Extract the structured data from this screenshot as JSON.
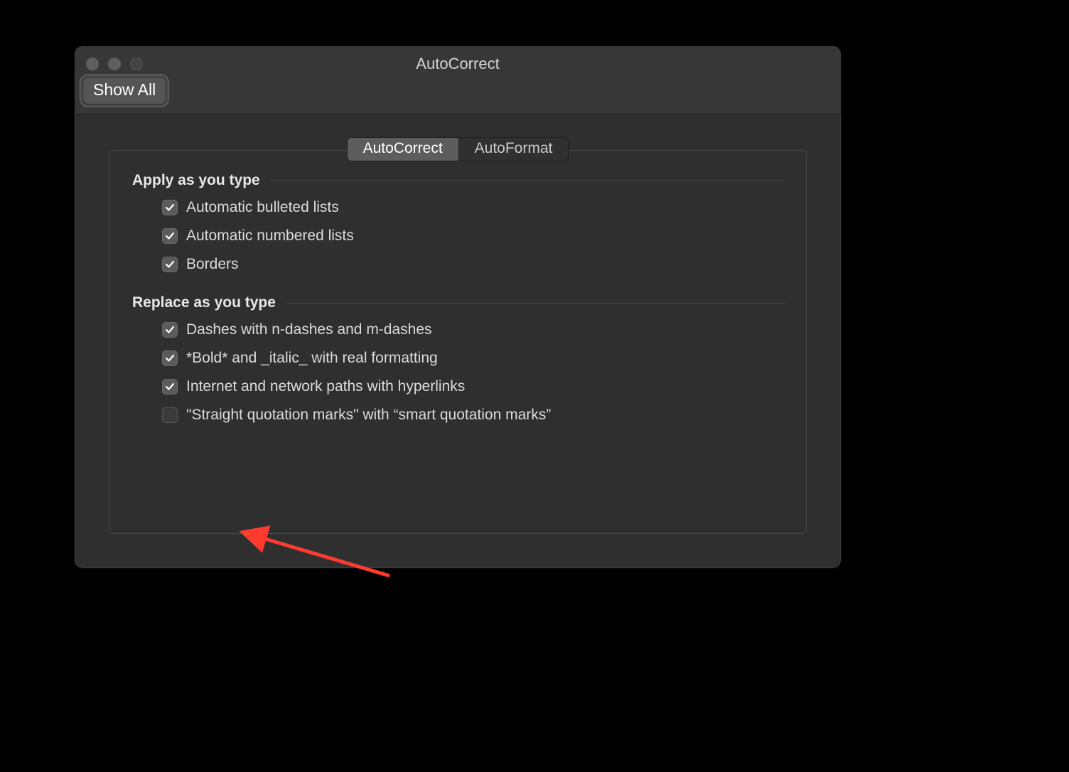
{
  "window": {
    "title": "AutoCorrect"
  },
  "toolbar": {
    "show_all_label": "Show All"
  },
  "tabs": [
    {
      "label": "AutoCorrect",
      "selected": true
    },
    {
      "label": "AutoFormat",
      "selected": false
    }
  ],
  "sections": {
    "apply": {
      "heading": "Apply as you type",
      "items": [
        {
          "label": "Automatic bulleted lists",
          "checked": true
        },
        {
          "label": "Automatic numbered lists",
          "checked": true
        },
        {
          "label": "Borders",
          "checked": true
        }
      ]
    },
    "replace": {
      "heading": "Replace as you type",
      "items": [
        {
          "label": "Dashes with n-dashes and m-dashes",
          "checked": true
        },
        {
          "label": "*Bold* and _italic_ with real formatting",
          "checked": true
        },
        {
          "label": "Internet and network paths with hyperlinks",
          "checked": true
        },
        {
          "label": "\"Straight quotation marks\" with “smart quotation marks”",
          "checked": false
        }
      ]
    }
  },
  "annotation": {
    "arrow_color": "#ff3b30"
  }
}
